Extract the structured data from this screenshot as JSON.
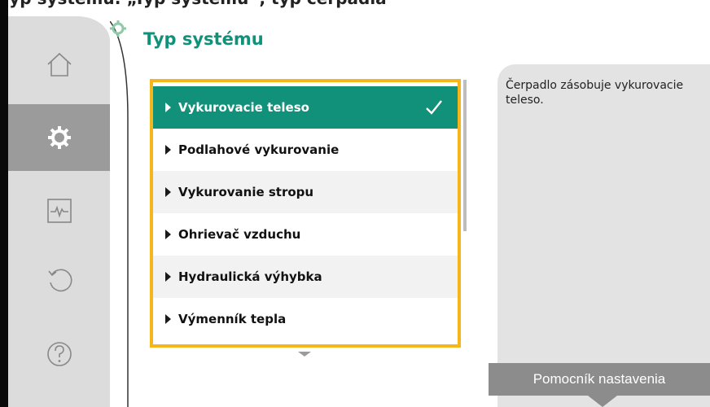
{
  "header": {
    "caption": "Typ systému: „Typ systému“, typ čerpadla"
  },
  "nav": {
    "items": [
      {
        "name": "home",
        "icon": "home-icon"
      },
      {
        "name": "settings",
        "icon": "gear-icon",
        "active": true
      },
      {
        "name": "diagnostics",
        "icon": "heartbeat-monitor-icon"
      },
      {
        "name": "restore",
        "icon": "undo-icon"
      },
      {
        "name": "help",
        "icon": "question-icon"
      }
    ]
  },
  "main": {
    "title": "Typ systému",
    "options": [
      {
        "label": "Vykurovacie teleso",
        "selected": true
      },
      {
        "label": "Podlahové vykurovanie",
        "selected": false
      },
      {
        "label": "Vykurovanie stropu",
        "selected": false
      },
      {
        "label": "Ohrievač vzduchu",
        "selected": false
      },
      {
        "label": "Hydraulická výhybka",
        "selected": false
      },
      {
        "label": "Výmenník tepla",
        "selected": false
      }
    ]
  },
  "help": {
    "text": "Čerpadlo zásobuje vykurovacie teleso."
  },
  "assistant": {
    "label": "Pomocník nastavenia"
  },
  "colors": {
    "accent": "#11907a",
    "focus_border": "#f5b61c",
    "rail": "#dcdcdc",
    "rail_active": "#9b9b9b"
  }
}
